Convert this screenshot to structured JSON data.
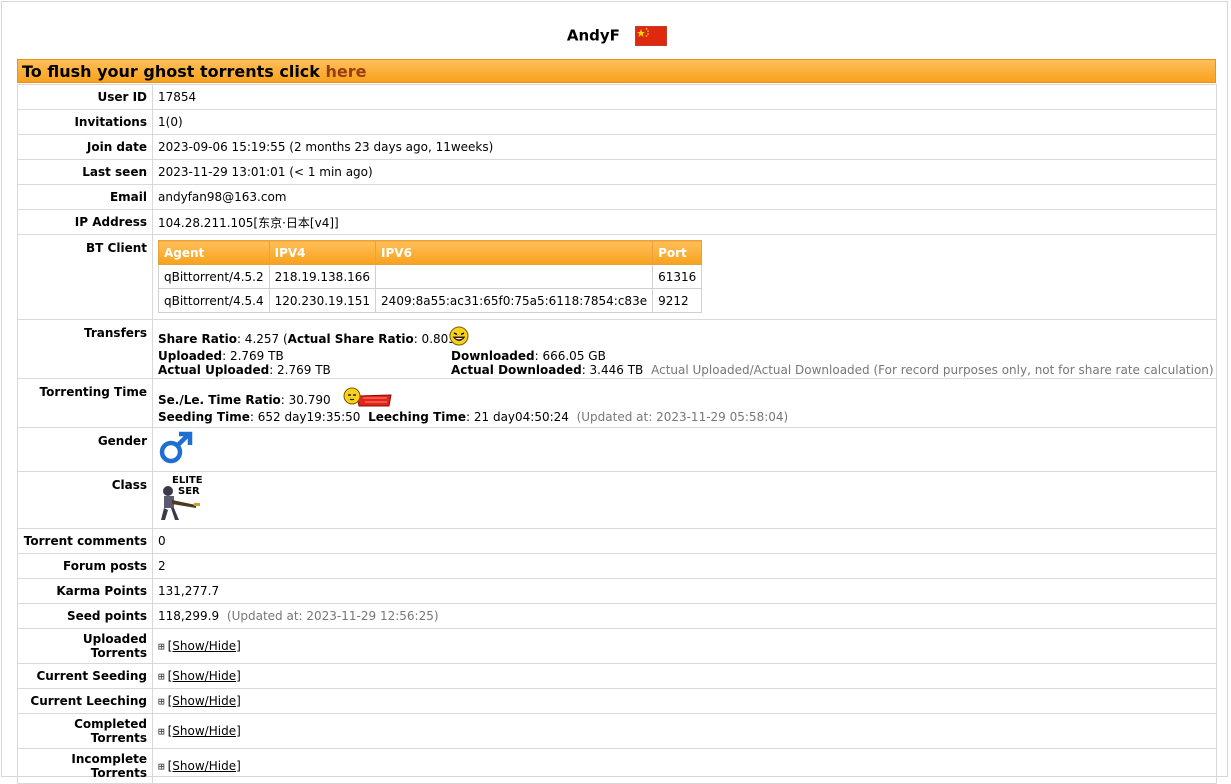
{
  "profile": {
    "username": "AndyF",
    "flag": "china-flag",
    "banner": {
      "text": "To flush your ghost torrents click ",
      "link": "here"
    }
  },
  "labels": {
    "user_id": "User ID",
    "invitations": "Invitations",
    "join_date": "Join date",
    "last_seen": "Last seen",
    "email": "Email",
    "ip": "IP Address",
    "bt_client": "BT Client",
    "transfers": "Transfers",
    "torrenting_time": "Torrenting Time",
    "gender": "Gender",
    "class": "Class",
    "torrent_comments": "Torrent comments",
    "forum_posts": "Forum posts",
    "karma": "Karma Points",
    "seed_points": "Seed points"
  },
  "values": {
    "user_id": "17854",
    "invitations": "1(0)",
    "join_date": "2023-09-06 15:19:55 (2 months 23 days ago, 11weeks)",
    "last_seen": "2023-11-29 13:01:01 (< 1 min ago)",
    "email": "andyfan98@163.com",
    "ip": "104.28.211.105[东京·日本[v4]]",
    "torrent_comments": "0",
    "forum_posts": "2",
    "karma": "131,277.7",
    "seed_points": "118,299.9",
    "seed_points_note": "(Updated at: 2023-11-29 12:56:25)"
  },
  "bt_client": {
    "headers": [
      "Agent",
      "IPV4",
      "IPV6",
      "Port"
    ],
    "rows": [
      [
        "qBittorrent/4.5.2",
        "218.19.138.166",
        "",
        "61316"
      ],
      [
        "qBittorrent/4.5.4",
        "120.230.19.151",
        "2409:8a55:ac31:65f0:75a5:6118:7854:c83e",
        "9212"
      ]
    ]
  },
  "transfers": {
    "share_ratio_label": "Share Ratio",
    "share_ratio": ": 4.257",
    "actual_ratio_label": "Actual Share Ratio",
    "actual_ratio": ":  0.803)",
    "uploaded_label": "Uploaded",
    "uploaded": ": 2.769 TB",
    "actual_uploaded_label": "Actual Uploaded",
    "actual_uploaded": ": 2.769 TB",
    "downloaded_label": "Downloaded",
    "downloaded": ": 666.05 GB",
    "actual_downloaded_label": "Actual Downloaded",
    "actual_downloaded": ": 3.446 TB",
    "note": "Actual Uploaded/Actual Downloaded (For record purposes only, not for share rate calculation)",
    "emoticon": "laughing-face-icon"
  },
  "torrenting_time": {
    "ratio_label": "Se./Le. Time Ratio",
    "ratio": ": 30.790",
    "seeding_label": "Seeding Time",
    "seeding": ": 652 day19:35:50",
    "leeching_label": "Leeching Time",
    "leeching": ": 21 day04:50:24",
    "note": "(Updated at: 2023-11-29 05:58:04)",
    "emoticon": "sleeping-emoticon-icon"
  },
  "gender": {
    "icon": "male-symbol-icon"
  },
  "class_badge": {
    "line1": "ELITE",
    "line2": "SER"
  },
  "sections": [
    {
      "label": "Uploaded Torrents",
      "link": "[Show/Hide]"
    },
    {
      "label": "Current Seeding",
      "link": "[Show/Hide]"
    },
    {
      "label": "Current Leeching",
      "link": "[Show/Hide]"
    },
    {
      "label": "Completed Torrents",
      "link": "[Show/Hide]"
    },
    {
      "label": "Incomplete Torrents",
      "link": "[Show/Hide]"
    }
  ],
  "colors": {
    "banner": "#f7a21d",
    "link": "#9a3b12",
    "male": "#1f6fd1"
  }
}
